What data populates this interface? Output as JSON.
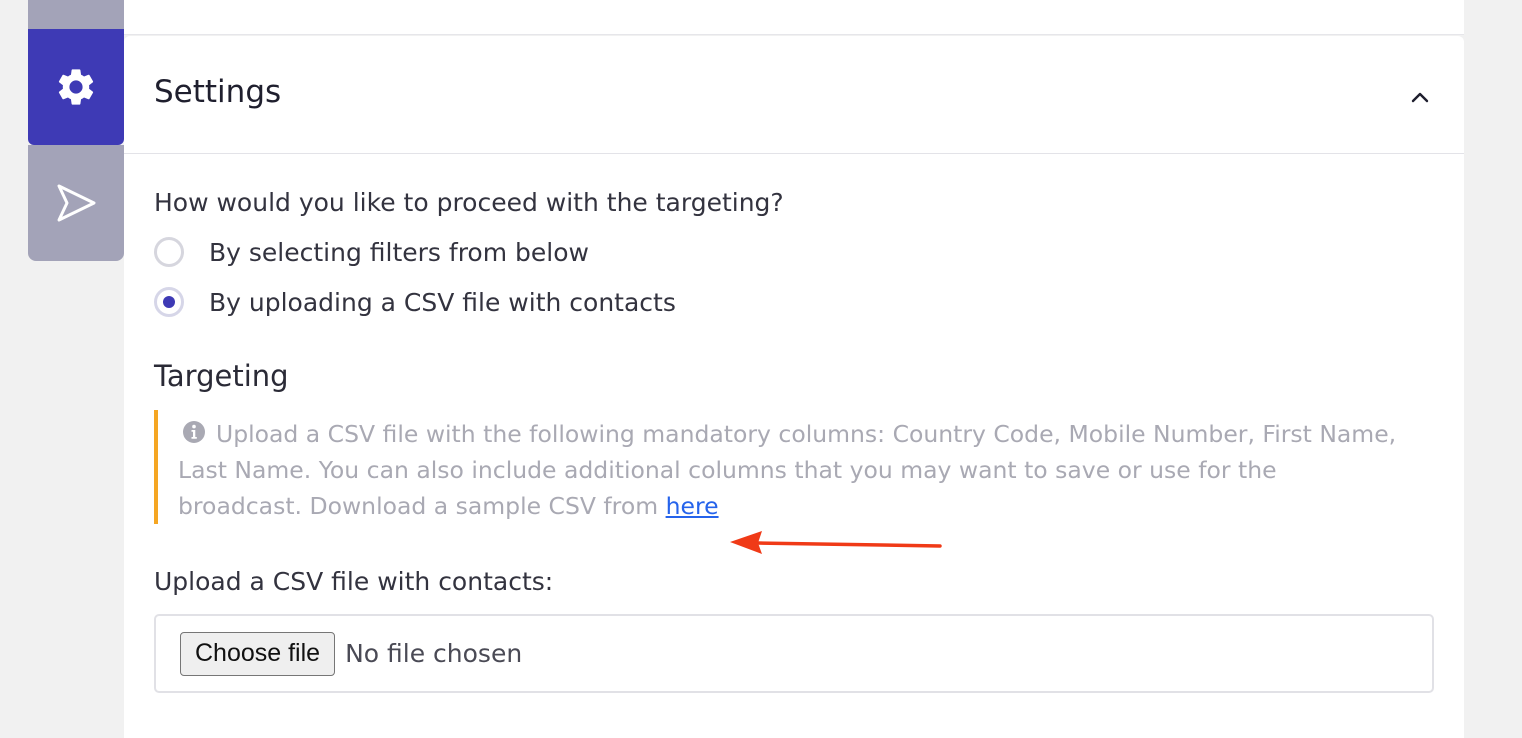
{
  "steps": [
    {
      "icon": "gear-icon",
      "active": true
    },
    {
      "icon": "send-icon",
      "active": false
    }
  ],
  "panel": {
    "title": "Settings",
    "toggle_icon": "chevron-up-icon"
  },
  "targeting_mode": {
    "question": "How would you like to proceed with the targeting?",
    "options": [
      {
        "label": "By selecting filters from below",
        "checked": false
      },
      {
        "label": "By uploading a CSV file with contacts",
        "checked": true
      }
    ]
  },
  "targeting": {
    "title": "Targeting",
    "info_text": "Upload a CSV file with the following mandatory columns: Country Code, Mobile Number, First Name, Last Name. You can also include additional columns that you may want to save or use for the broadcast. Download a sample CSV from",
    "link_text": "here"
  },
  "upload": {
    "label": "Upload a CSV file with contacts:",
    "button_label": "Choose file",
    "status": "No file chosen"
  },
  "colors": {
    "accent": "#3e3ab5",
    "rail_inactive": "#a3a3b8",
    "info_border": "#f5a623",
    "link": "#2563eb",
    "annotation_arrow": "#f03a17"
  }
}
